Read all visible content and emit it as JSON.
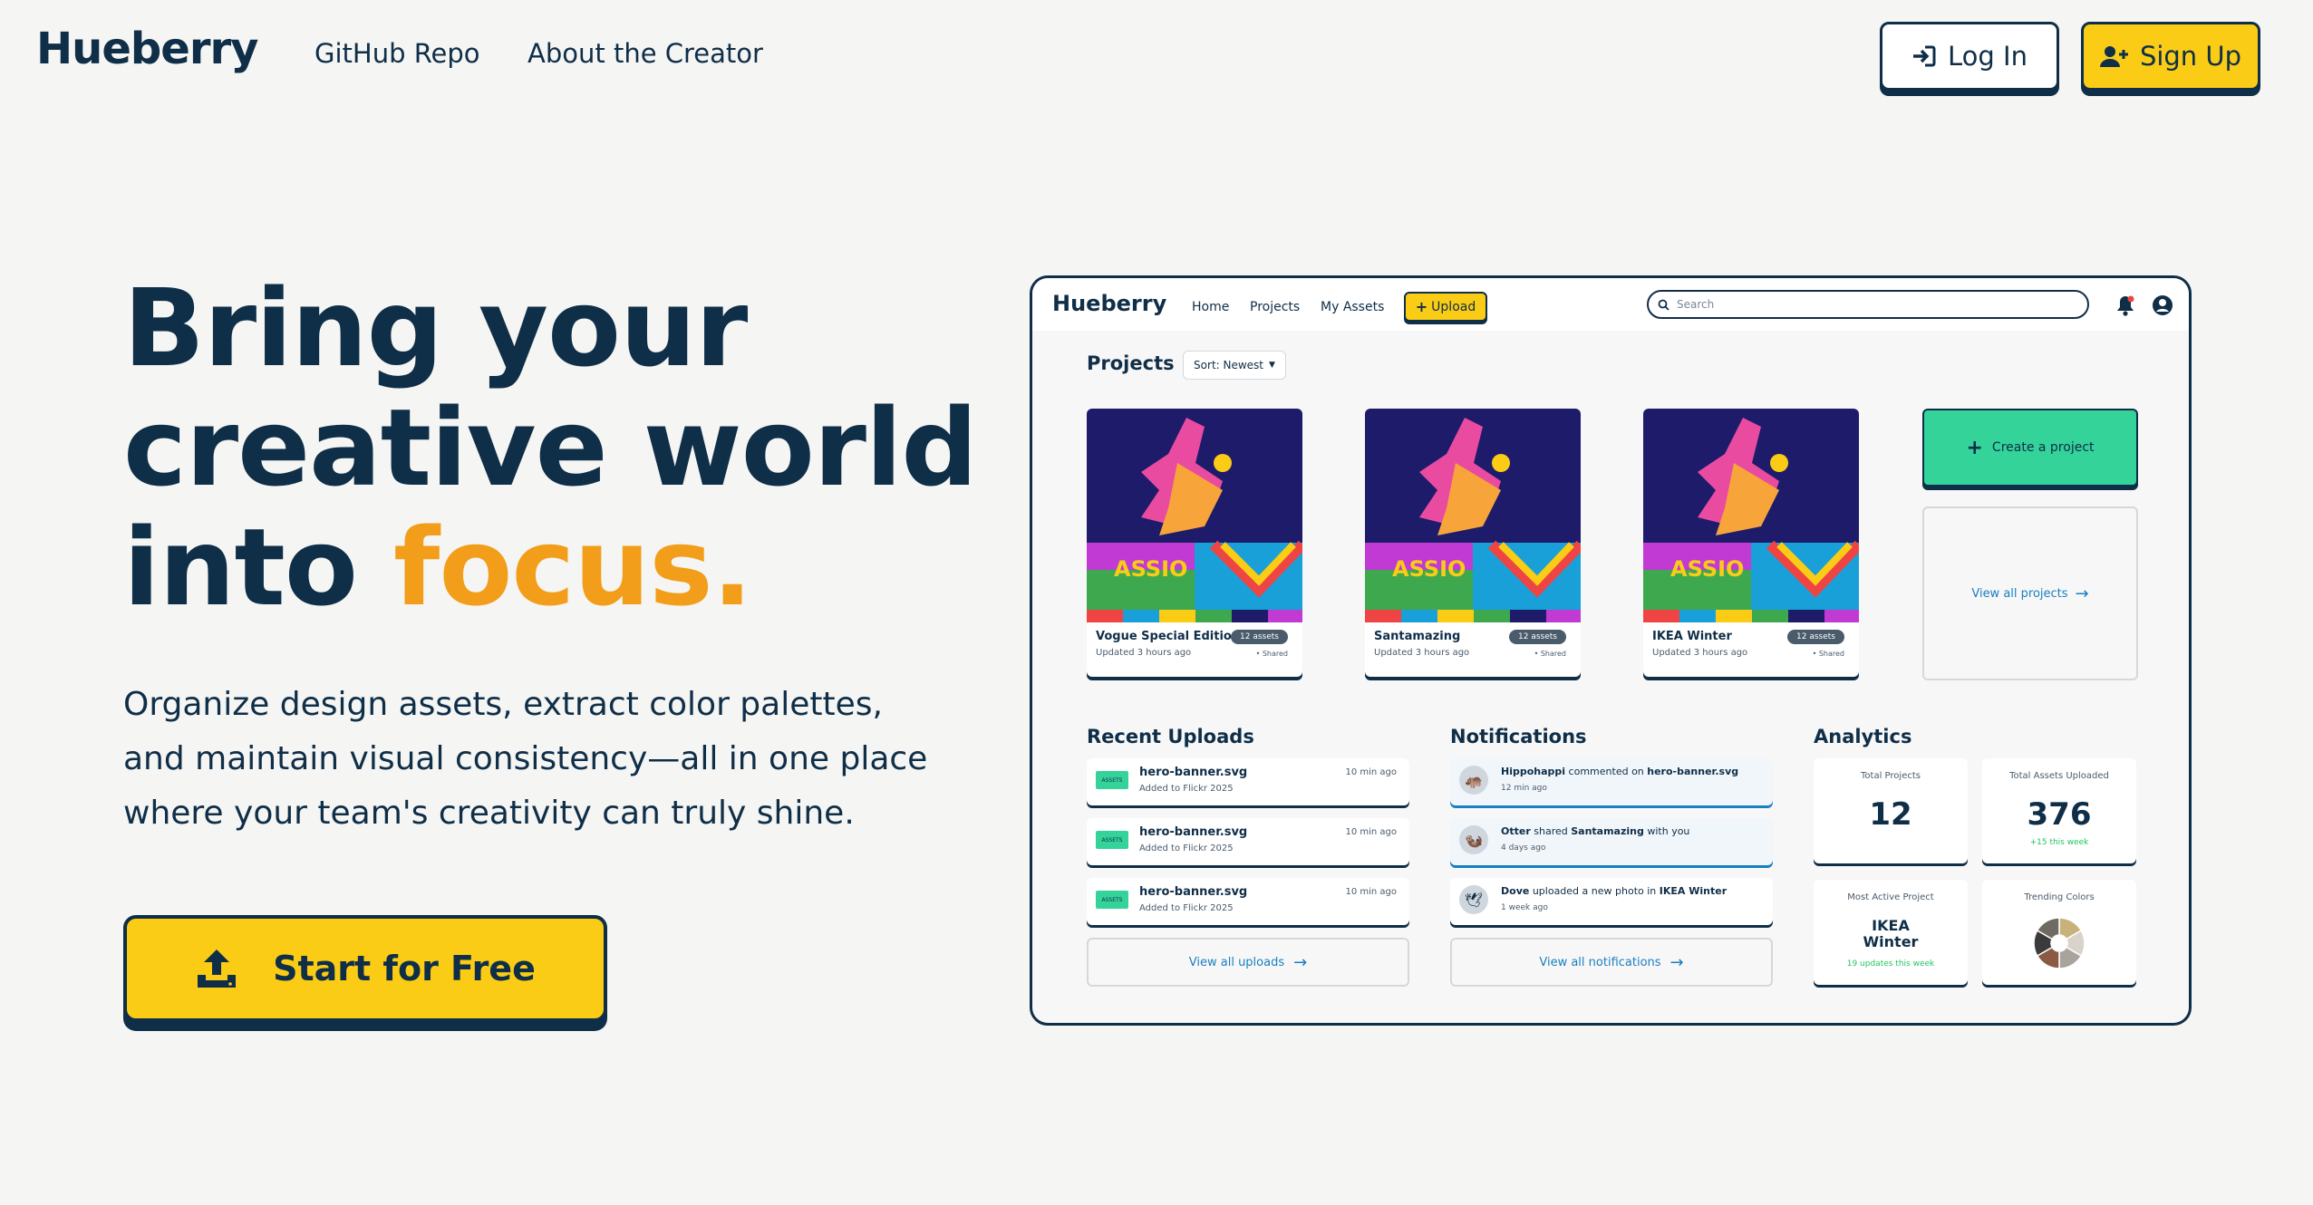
{
  "nav": {
    "brand": "Hueberry",
    "links": [
      "GitHub Repo",
      "About the Creator"
    ],
    "login_label": "Log In",
    "signup_label": "Sign Up"
  },
  "hero": {
    "title_line1": "Bring your",
    "title_line2": "creative world",
    "title_line3_plain": "into ",
    "title_line3_accent": "focus.",
    "subtitle_line1": "Organize design assets, extract color palettes,",
    "subtitle_line2": "and maintain visual consistency—all in one place",
    "subtitle_line3": "where your team's creativity can truly shine.",
    "cta_label": "Start for Free"
  },
  "colors": {
    "navy": "#0f2e48",
    "accent_orange": "#f29e1a",
    "yellow": "#facc15",
    "green": "#34d399",
    "link_blue": "#1a7fc1",
    "background": "#f5f5f3"
  },
  "mockup": {
    "brand": "Hueberry",
    "nav_links": [
      "Home",
      "Projects",
      "My Assets"
    ],
    "upload_label": "Upload",
    "search_placeholder": "Search",
    "projects": {
      "title": "Projects",
      "sort_label": "Sort: Newest",
      "items": [
        {
          "name": "Vogue Special Edition",
          "updated": "Updated 3 hours ago",
          "badge": "12 assets",
          "shared": "• Shared"
        },
        {
          "name": "Santamazing",
          "updated": "Updated 3 hours ago",
          "badge": "12 assets",
          "shared": "• Shared"
        },
        {
          "name": "IKEA Winter",
          "updated": "Updated 3 hours ago",
          "badge": "12 assets",
          "shared": "• Shared"
        }
      ],
      "create_label": "Create a project",
      "view_all_label": "View all projects"
    },
    "uploads": {
      "title": "Recent Uploads",
      "items": [
        {
          "name": "hero-banner.svg",
          "sub": "Added to Flickr 2025",
          "time": "10 min ago"
        },
        {
          "name": "hero-banner.svg",
          "sub": "Added to Flickr 2025",
          "time": "10 min ago"
        },
        {
          "name": "hero-banner.svg",
          "sub": "Added to Flickr 2025",
          "time": "10 min ago"
        }
      ],
      "view_all_label": "View all uploads"
    },
    "notifications": {
      "title": "Notifications",
      "items": [
        {
          "actor": "Hippohappi",
          "action": " commented on ",
          "target": "hero-banner.svg",
          "tail": "",
          "time": "12 min ago"
        },
        {
          "actor": "Otter",
          "action": " shared ",
          "target": "Santamazing",
          "tail": " with you",
          "time": "4 days ago"
        },
        {
          "actor": "Dove",
          "action": " uploaded a new photo in ",
          "target": "IKEA Winter",
          "tail": "",
          "time": "1 week ago"
        }
      ],
      "view_all_label": "View all notifications"
    },
    "analytics": {
      "title": "Analytics",
      "total_projects_label": "Total Projects",
      "total_projects_value": "12",
      "total_assets_label": "Total Assets Uploaded",
      "total_assets_value": "376",
      "total_assets_sub": "+15 this week",
      "most_active_label": "Most Active Project",
      "most_active_line1": "IKEA",
      "most_active_line2": "Winter",
      "most_active_sub": "19 updates this week",
      "trending_label": "Trending Colors",
      "trending_colors": [
        "#c8b27a",
        "#d9d3c9",
        "#a8a39b",
        "#8b5a45",
        "#3b3b3b",
        "#6f6a62"
      ]
    }
  }
}
